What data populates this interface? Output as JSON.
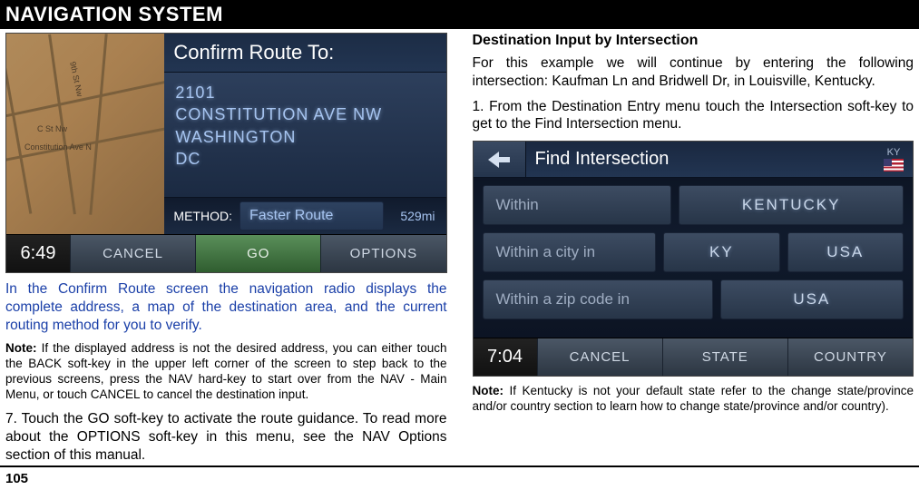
{
  "header": {
    "title": "NAVIGATION SYSTEM"
  },
  "page_number": "105",
  "screenshot1": {
    "title": "Confirm Route To:",
    "address_number": "2101",
    "address_line1": "CONSTITUTION AVE NW",
    "address_city": "WASHINGTON",
    "address_state": "DC",
    "map_street1": "C St Nw",
    "map_street2": "Constitution Ave N",
    "map_street3": "9th St Nw",
    "method_label": "METHOD:",
    "method_value": "Faster Route",
    "distance": "529mi",
    "time": "6:49",
    "btn_cancel": "CANCEL",
    "btn_go": "GO",
    "btn_options": "OPTIONS"
  },
  "left": {
    "para1": "In the Confirm Route screen the navigation radio displays the complete address, a map of the destination area, and the current routing method for you to verify.",
    "note1_label": "Note:",
    "note1": " If the displayed address is not the desired address, you can either touch the BACK soft-key in the upper left corner of the screen to step back to the previous screens, press the NAV hard-key to  start over from the NAV - Main Menu, or touch CANCEL to cancel the destination input.",
    "para2": "7. Touch the GO soft-key to activate the route guidance. To read more about the OPTIONS soft-key in this menu, see the NAV Options section of this manual."
  },
  "right": {
    "subhead": "Destination Input by Intersection",
    "para1": "For this example we will continue by entering the following intersection: Kaufman Ln and Bridwell Dr, in Louisville, Kentucky.",
    "para2": "1. From the Destination Entry menu touch the Intersection soft-key to get to the Find Intersection menu.",
    "note1_label": "Note:",
    "note1": " If Kentucky is not your default state refer to the change state/province and/or country section to learn how to change state/province and/or country)."
  },
  "screenshot2": {
    "title": "Find Intersection",
    "state_abbr": "KY",
    "row1_label": "Within",
    "row1_value": "KENTUCKY",
    "row2_label": "Within a city in",
    "row2_val1": "KY",
    "row2_val2": "USA",
    "row3_label": "Within a zip code in",
    "row3_value": "USA",
    "time": "7:04",
    "btn_cancel": "CANCEL",
    "btn_state": "STATE",
    "btn_country": "COUNTRY"
  }
}
